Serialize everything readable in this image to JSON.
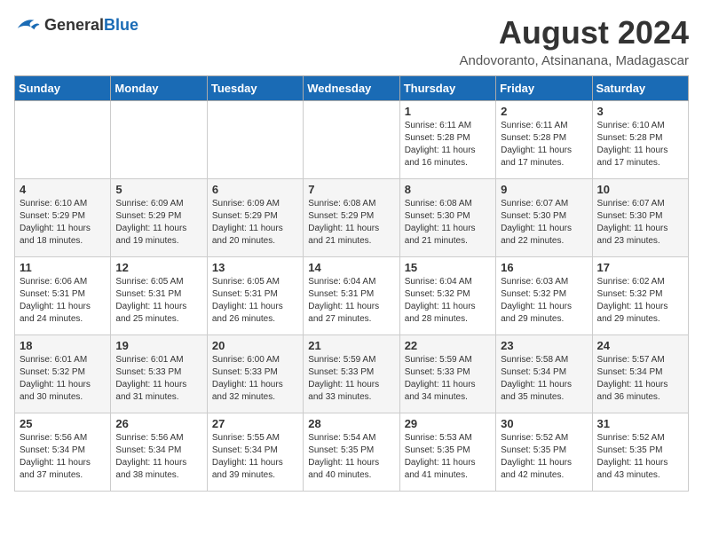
{
  "header": {
    "logo_general": "General",
    "logo_blue": "Blue",
    "month_year": "August 2024",
    "location": "Andovoranto, Atsinanana, Madagascar"
  },
  "weekdays": [
    "Sunday",
    "Monday",
    "Tuesday",
    "Wednesday",
    "Thursday",
    "Friday",
    "Saturday"
  ],
  "weeks": [
    [
      {
        "day": "",
        "info": ""
      },
      {
        "day": "",
        "info": ""
      },
      {
        "day": "",
        "info": ""
      },
      {
        "day": "",
        "info": ""
      },
      {
        "day": "1",
        "info": "Sunrise: 6:11 AM\nSunset: 5:28 PM\nDaylight: 11 hours\nand 16 minutes."
      },
      {
        "day": "2",
        "info": "Sunrise: 6:11 AM\nSunset: 5:28 PM\nDaylight: 11 hours\nand 17 minutes."
      },
      {
        "day": "3",
        "info": "Sunrise: 6:10 AM\nSunset: 5:28 PM\nDaylight: 11 hours\nand 17 minutes."
      }
    ],
    [
      {
        "day": "4",
        "info": "Sunrise: 6:10 AM\nSunset: 5:29 PM\nDaylight: 11 hours\nand 18 minutes."
      },
      {
        "day": "5",
        "info": "Sunrise: 6:09 AM\nSunset: 5:29 PM\nDaylight: 11 hours\nand 19 minutes."
      },
      {
        "day": "6",
        "info": "Sunrise: 6:09 AM\nSunset: 5:29 PM\nDaylight: 11 hours\nand 20 minutes."
      },
      {
        "day": "7",
        "info": "Sunrise: 6:08 AM\nSunset: 5:29 PM\nDaylight: 11 hours\nand 21 minutes."
      },
      {
        "day": "8",
        "info": "Sunrise: 6:08 AM\nSunset: 5:30 PM\nDaylight: 11 hours\nand 21 minutes."
      },
      {
        "day": "9",
        "info": "Sunrise: 6:07 AM\nSunset: 5:30 PM\nDaylight: 11 hours\nand 22 minutes."
      },
      {
        "day": "10",
        "info": "Sunrise: 6:07 AM\nSunset: 5:30 PM\nDaylight: 11 hours\nand 23 minutes."
      }
    ],
    [
      {
        "day": "11",
        "info": "Sunrise: 6:06 AM\nSunset: 5:31 PM\nDaylight: 11 hours\nand 24 minutes."
      },
      {
        "day": "12",
        "info": "Sunrise: 6:05 AM\nSunset: 5:31 PM\nDaylight: 11 hours\nand 25 minutes."
      },
      {
        "day": "13",
        "info": "Sunrise: 6:05 AM\nSunset: 5:31 PM\nDaylight: 11 hours\nand 26 minutes."
      },
      {
        "day": "14",
        "info": "Sunrise: 6:04 AM\nSunset: 5:31 PM\nDaylight: 11 hours\nand 27 minutes."
      },
      {
        "day": "15",
        "info": "Sunrise: 6:04 AM\nSunset: 5:32 PM\nDaylight: 11 hours\nand 28 minutes."
      },
      {
        "day": "16",
        "info": "Sunrise: 6:03 AM\nSunset: 5:32 PM\nDaylight: 11 hours\nand 29 minutes."
      },
      {
        "day": "17",
        "info": "Sunrise: 6:02 AM\nSunset: 5:32 PM\nDaylight: 11 hours\nand 29 minutes."
      }
    ],
    [
      {
        "day": "18",
        "info": "Sunrise: 6:01 AM\nSunset: 5:32 PM\nDaylight: 11 hours\nand 30 minutes."
      },
      {
        "day": "19",
        "info": "Sunrise: 6:01 AM\nSunset: 5:33 PM\nDaylight: 11 hours\nand 31 minutes."
      },
      {
        "day": "20",
        "info": "Sunrise: 6:00 AM\nSunset: 5:33 PM\nDaylight: 11 hours\nand 32 minutes."
      },
      {
        "day": "21",
        "info": "Sunrise: 5:59 AM\nSunset: 5:33 PM\nDaylight: 11 hours\nand 33 minutes."
      },
      {
        "day": "22",
        "info": "Sunrise: 5:59 AM\nSunset: 5:33 PM\nDaylight: 11 hours\nand 34 minutes."
      },
      {
        "day": "23",
        "info": "Sunrise: 5:58 AM\nSunset: 5:34 PM\nDaylight: 11 hours\nand 35 minutes."
      },
      {
        "day": "24",
        "info": "Sunrise: 5:57 AM\nSunset: 5:34 PM\nDaylight: 11 hours\nand 36 minutes."
      }
    ],
    [
      {
        "day": "25",
        "info": "Sunrise: 5:56 AM\nSunset: 5:34 PM\nDaylight: 11 hours\nand 37 minutes."
      },
      {
        "day": "26",
        "info": "Sunrise: 5:56 AM\nSunset: 5:34 PM\nDaylight: 11 hours\nand 38 minutes."
      },
      {
        "day": "27",
        "info": "Sunrise: 5:55 AM\nSunset: 5:34 PM\nDaylight: 11 hours\nand 39 minutes."
      },
      {
        "day": "28",
        "info": "Sunrise: 5:54 AM\nSunset: 5:35 PM\nDaylight: 11 hours\nand 40 minutes."
      },
      {
        "day": "29",
        "info": "Sunrise: 5:53 AM\nSunset: 5:35 PM\nDaylight: 11 hours\nand 41 minutes."
      },
      {
        "day": "30",
        "info": "Sunrise: 5:52 AM\nSunset: 5:35 PM\nDaylight: 11 hours\nand 42 minutes."
      },
      {
        "day": "31",
        "info": "Sunrise: 5:52 AM\nSunset: 5:35 PM\nDaylight: 11 hours\nand 43 minutes."
      }
    ]
  ]
}
